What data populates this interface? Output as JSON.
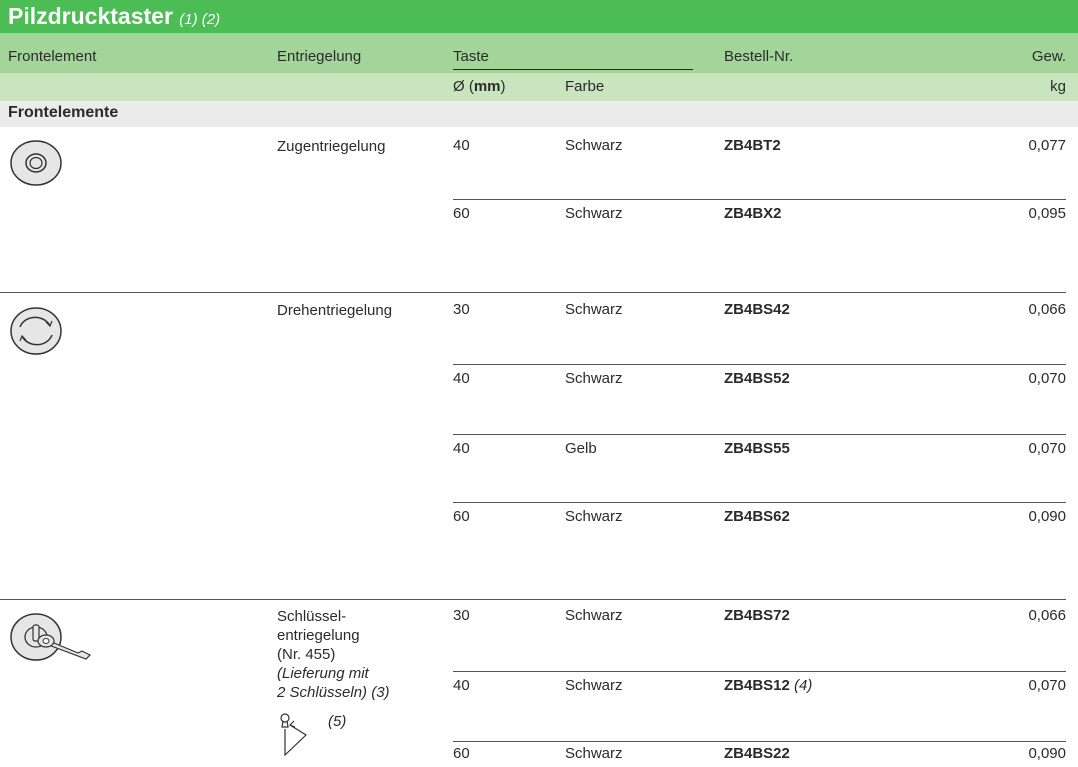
{
  "title": "Pilzdrucktaster",
  "title_note": "(1) (2)",
  "headers": {
    "frontelement": "Frontelement",
    "entriegelung": "Entriegelung",
    "taste": "Taste",
    "bestell": "Bestell-Nr.",
    "gew": "Gew.",
    "diam_prefix": "Ø (",
    "diam_unit": "mm",
    "diam_suffix": ")",
    "farbe": "Farbe",
    "kg": "kg"
  },
  "section_title": "Frontelemente",
  "groups": [
    {
      "icon": "pull-release-icon",
      "label_lines": [
        "Zugentriegelung"
      ],
      "rows": [
        {
          "d": "40",
          "farbe": "Schwarz",
          "nr": "ZB4BT2",
          "note": "",
          "gew": "0,077"
        },
        {
          "d": "60",
          "farbe": "Schwarz",
          "nr": "ZB4BX2",
          "note": "",
          "gew": "0,095"
        }
      ]
    },
    {
      "icon": "turn-release-icon",
      "label_lines": [
        "Drehentriegelung"
      ],
      "rows": [
        {
          "d": "30",
          "farbe": "Schwarz",
          "nr": "ZB4BS42",
          "note": "",
          "gew": "0,066"
        },
        {
          "d": "40",
          "farbe": "Schwarz",
          "nr": "ZB4BS52",
          "note": "",
          "gew": "0,070"
        },
        {
          "d": "40",
          "farbe": "Gelb",
          "nr": "ZB4BS55",
          "note": "",
          "gew": "0,070"
        },
        {
          "d": "60",
          "farbe": "Schwarz",
          "nr": "ZB4BS62",
          "note": "",
          "gew": "0,090"
        }
      ]
    },
    {
      "icon": "key-release-icon",
      "label_lines": [
        "Schlüssel-",
        "entriegelung",
        "(Nr. 455)"
      ],
      "label_italic_lines": [
        "(Lieferung mit",
        "2 Schlüsseln) (3)"
      ],
      "key_note": "(5)",
      "rows": [
        {
          "d": "30",
          "farbe": "Schwarz",
          "nr": "ZB4BS72",
          "note": "",
          "gew": "0,066"
        },
        {
          "d": "40",
          "farbe": "Schwarz",
          "nr": "ZB4BS12",
          "note": "(4)",
          "gew": "0,070"
        },
        {
          "d": "60",
          "farbe": "Schwarz",
          "nr": "ZB4BS22",
          "note": "",
          "gew": "0,090"
        }
      ]
    }
  ]
}
